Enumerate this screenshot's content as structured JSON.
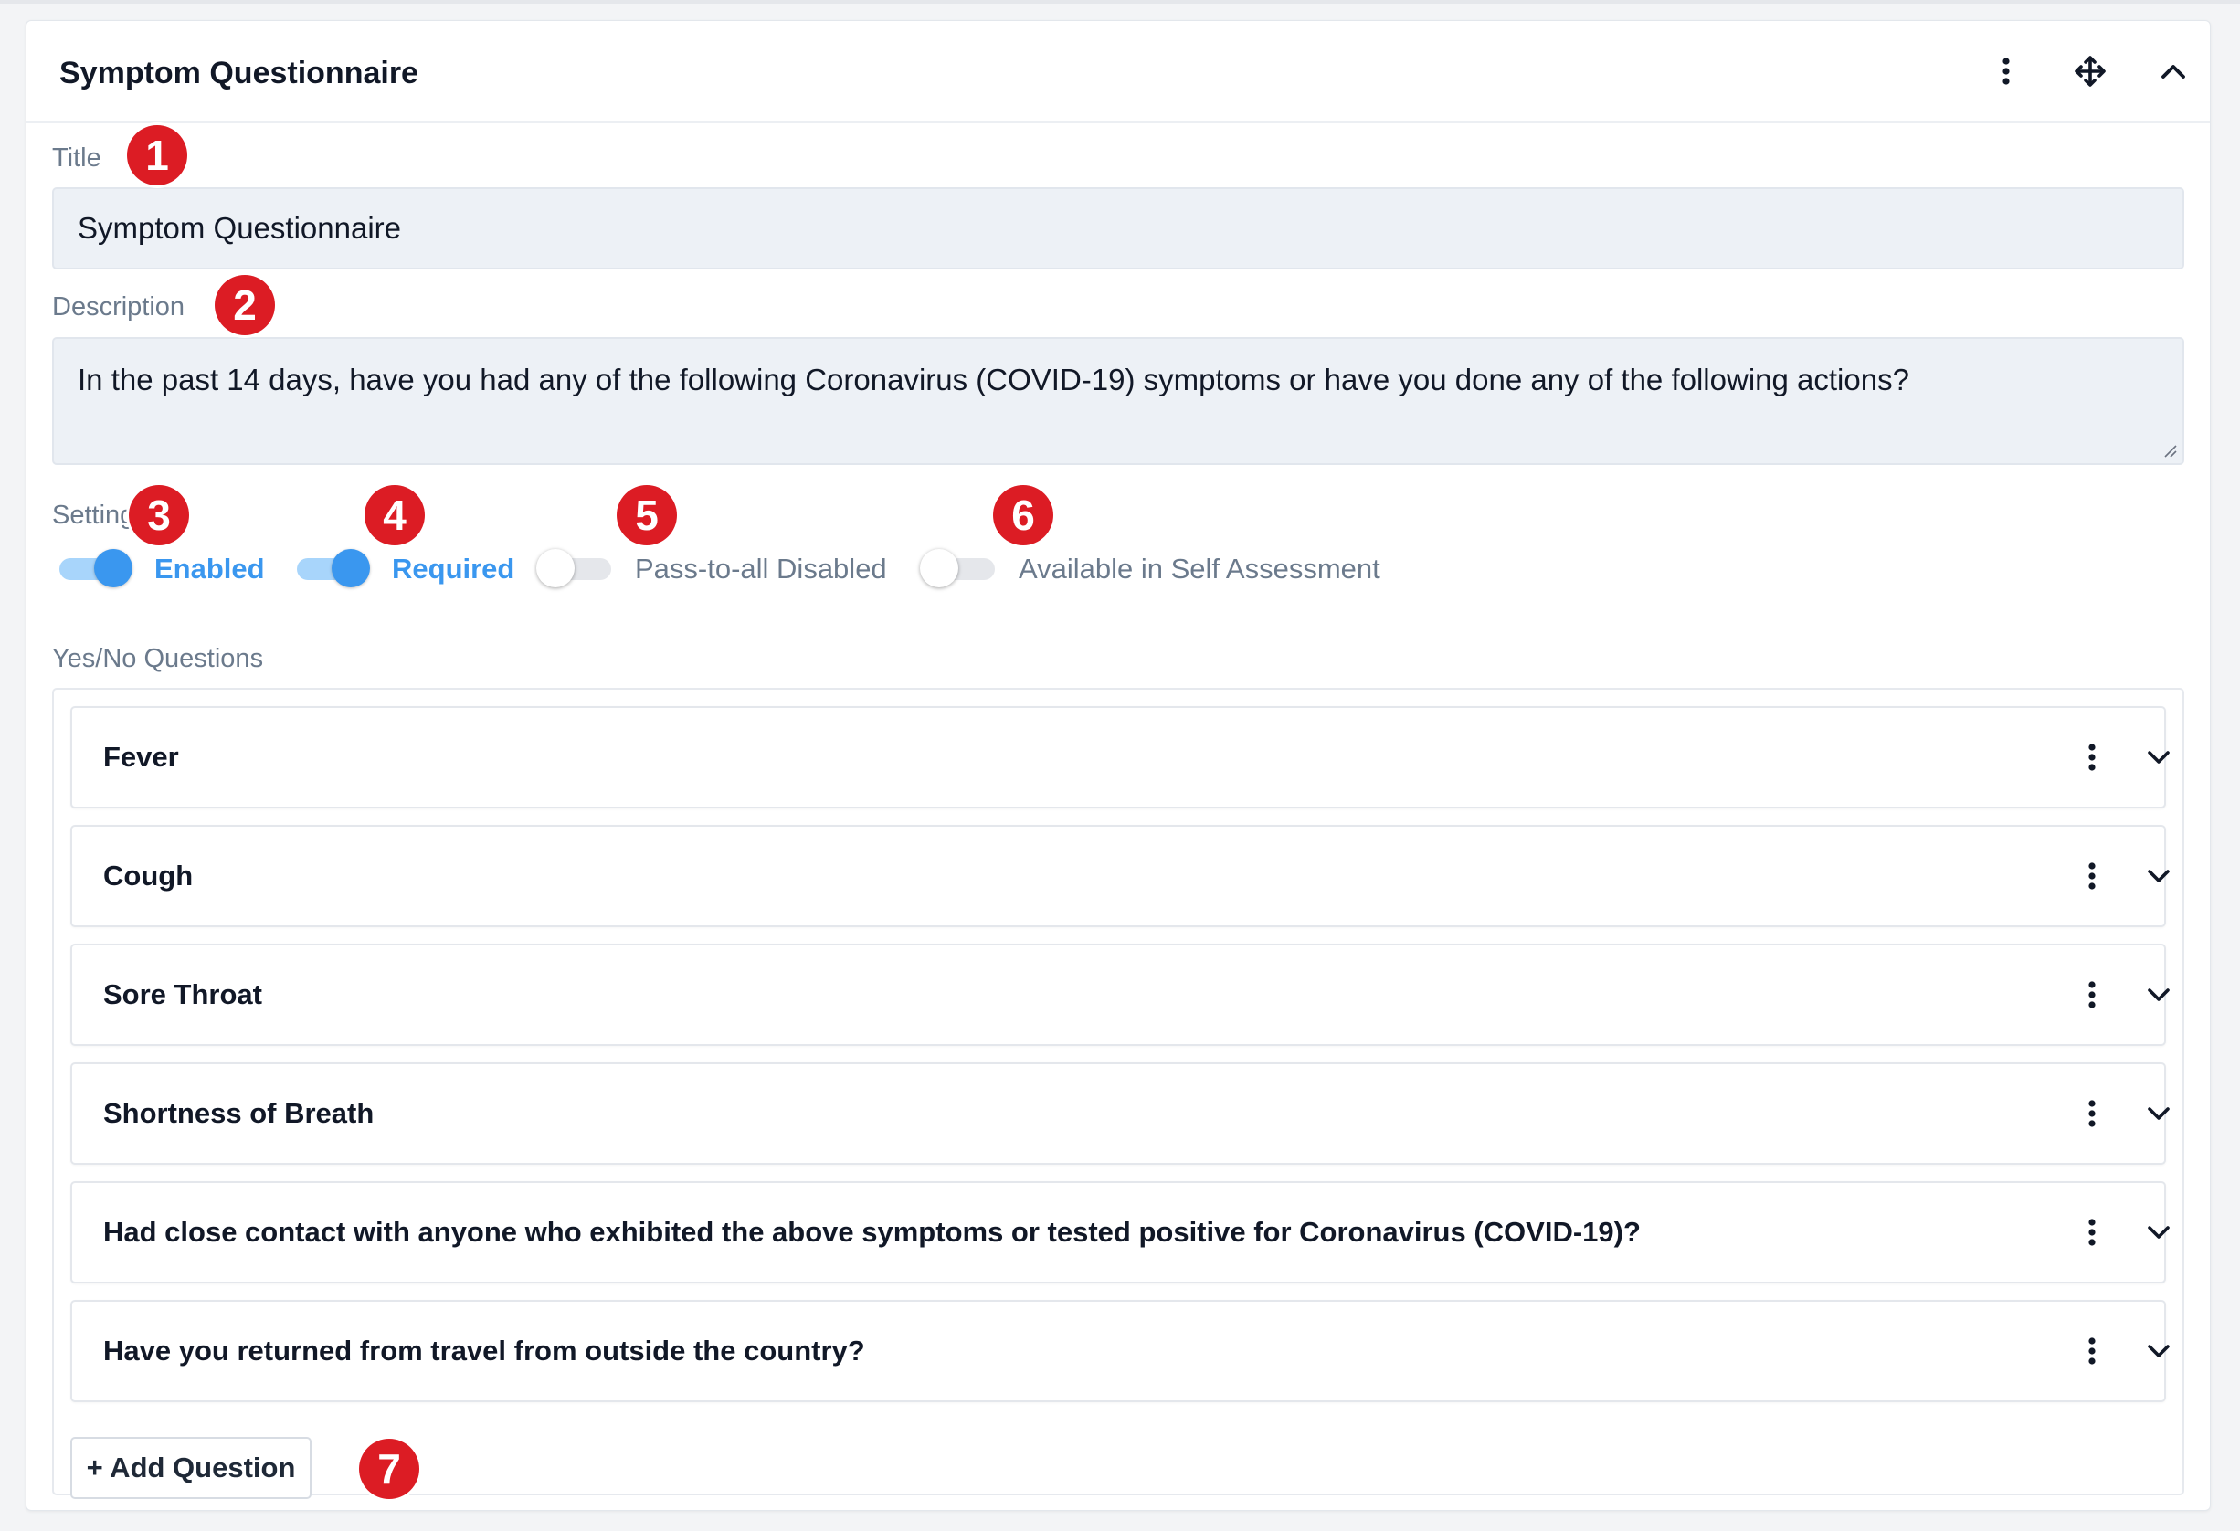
{
  "panel": {
    "title": "Symptom Questionnaire",
    "header_icons": [
      "more-vertical-icon",
      "move-icon",
      "chevron-up-icon"
    ]
  },
  "form": {
    "title_label": "Title",
    "title_value": "Symptom Questionnaire",
    "description_label": "Description",
    "description_value": "In the past 14 days, have you had any of the following Coronavirus (COVID-19) symptoms or have you done any of the following actions?",
    "settings_label": "Settings"
  },
  "settings": {
    "enabled": {
      "label": "Enabled",
      "on": true
    },
    "required": {
      "label": "Required",
      "on": true
    },
    "pass_to_all_disabled": {
      "label": "Pass-to-all Disabled",
      "on": false
    },
    "self_assessment": {
      "label": "Available in Self Assessment",
      "on": false
    }
  },
  "questions": {
    "section_label": "Yes/No Questions",
    "items": [
      "Fever",
      "Cough",
      "Sore Throat",
      "Shortness of Breath",
      "Had close contact with anyone who exhibited the above symptoms or tested positive for Coronavirus (COVID-19)?",
      "Have you returned from travel from outside the country?"
    ],
    "row_icons": [
      "more-vertical-icon",
      "chevron-down-icon"
    ],
    "add_button_label": "+ Add Question"
  },
  "annotations": [
    "1",
    "2",
    "3",
    "4",
    "5",
    "6",
    "7"
  ],
  "colors": {
    "accent": "#3a97ef",
    "toggle_track_on": "#a8d5fb",
    "annotation_badge": "#dc1c24",
    "input_background": "#edf1f6"
  }
}
